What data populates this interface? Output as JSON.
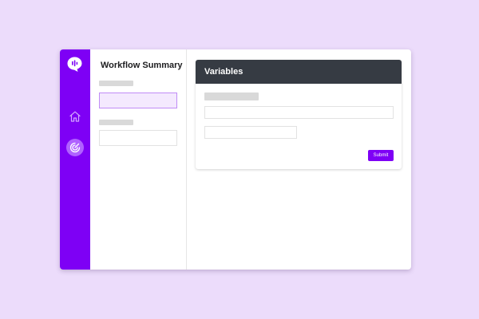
{
  "colors": {
    "background": "#ecdcfb",
    "brand": "#7e00f5",
    "brand_light": "#b062ff",
    "header_dark": "#363b43",
    "field_active_bg": "#f4e9fe"
  },
  "rail": {
    "logo_icon": "chat-bubble-logo-icon",
    "items": [
      {
        "icon": "home-icon",
        "active": false
      },
      {
        "icon": "radar-icon",
        "active": true
      }
    ]
  },
  "summary": {
    "title": "Workflow Summary"
  },
  "variables": {
    "title": "Variables",
    "submit_label": "Submit"
  }
}
